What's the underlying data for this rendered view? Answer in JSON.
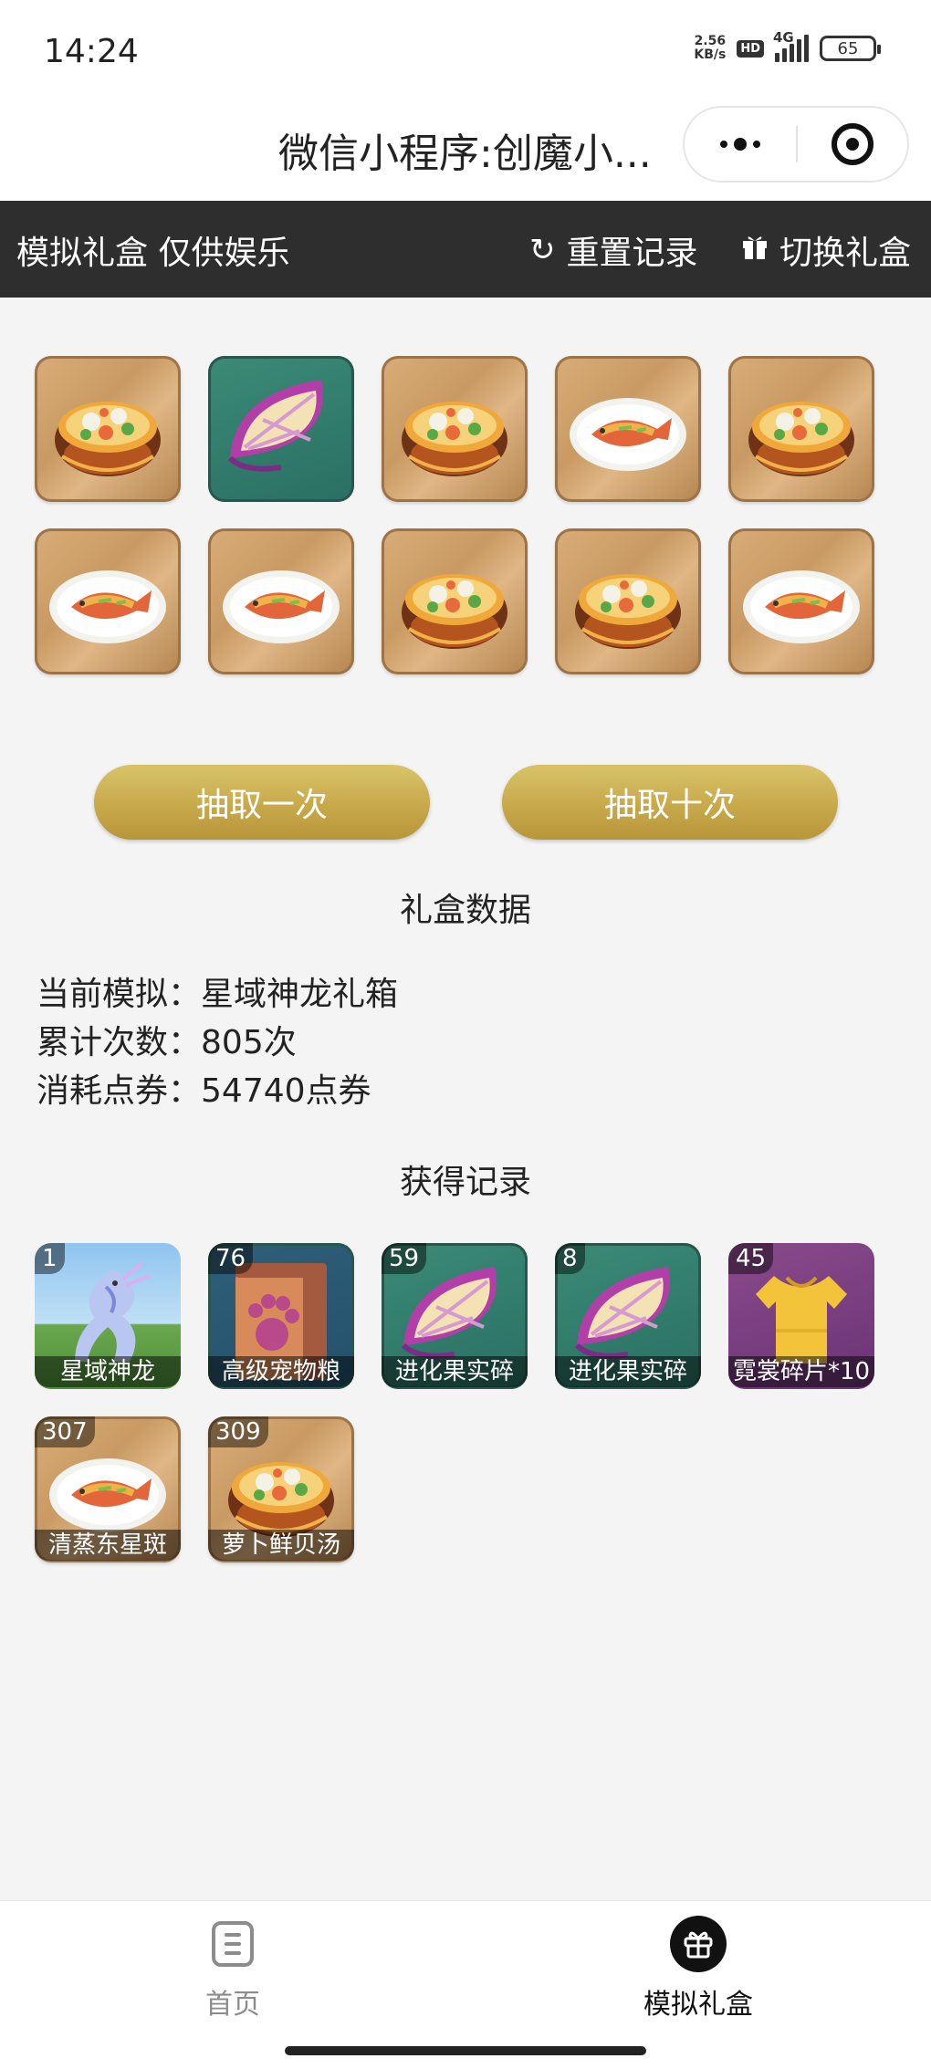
{
  "status": {
    "time": "14:24",
    "net_speed_value": "2.56",
    "net_speed_unit": "KB/s",
    "hd": "HD",
    "network": "4G",
    "battery": "65"
  },
  "nav": {
    "title": "微信小程序:创魔小..."
  },
  "toolbar": {
    "title": "模拟礼盒 仅供娱乐",
    "reset_label": "重置记录",
    "switch_label": "切换礼盒"
  },
  "draw_results": [
    {
      "item": "soup-bowl-icon"
    },
    {
      "item": "fruit-slice-icon"
    },
    {
      "item": "soup-bowl-icon"
    },
    {
      "item": "fish-plate-icon"
    },
    {
      "item": "soup-bowl-icon"
    },
    {
      "item": "fish-plate-icon"
    },
    {
      "item": "fish-plate-icon"
    },
    {
      "item": "soup-bowl-icon"
    },
    {
      "item": "soup-bowl-icon"
    },
    {
      "item": "fish-plate-icon"
    }
  ],
  "buttons": {
    "draw_once": "抽取一次",
    "draw_ten": "抽取十次"
  },
  "box_data": {
    "title": "礼盒数据",
    "current_label": "当前模拟：",
    "current_value": "星域神龙礼箱",
    "count_label": "累计次数：",
    "count_value": "805次",
    "cost_label": "消耗点券：",
    "cost_value": "54740点券"
  },
  "records": {
    "title": "获得记录",
    "items": [
      {
        "count": "1",
        "name": "星域神龙",
        "icon": "dragon-icon"
      },
      {
        "count": "76",
        "name": "高级宠物粮",
        "icon": "pet-food-bag-icon"
      },
      {
        "count": "59",
        "name": "进化果实碎",
        "icon": "fruit-slice-icon"
      },
      {
        "count": "8",
        "name": "进化果实碎",
        "icon": "fruit-slice-icon"
      },
      {
        "count": "45",
        "name": "霓裳碎片*10",
        "icon": "shirt-icon"
      },
      {
        "count": "307",
        "name": "清蒸东星斑",
        "icon": "fish-plate-icon"
      },
      {
        "count": "309",
        "name": "萝卜鲜贝汤",
        "icon": "soup-bowl-icon"
      }
    ]
  },
  "tabbar": {
    "home": "首页",
    "gift_box": "模拟礼盒"
  }
}
